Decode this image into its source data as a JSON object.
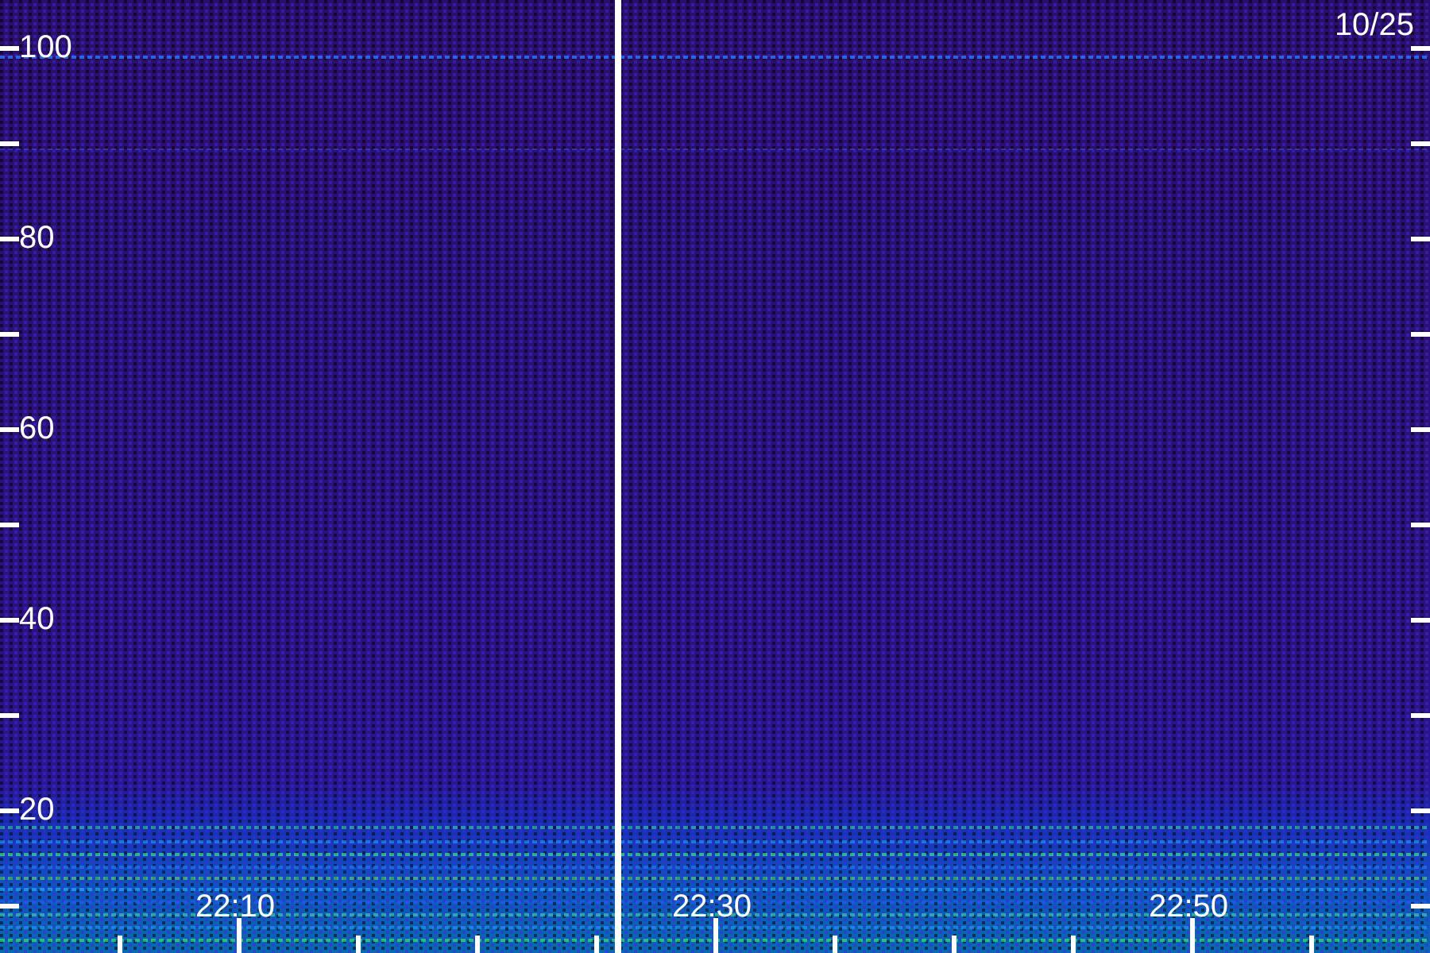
{
  "date": "10/25",
  "y_axis": {
    "labels": [
      "100",
      "80",
      "60",
      "40",
      "20"
    ]
  },
  "x_axis": {
    "labels": [
      "22:10",
      "22:30",
      "22:50"
    ]
  }
}
